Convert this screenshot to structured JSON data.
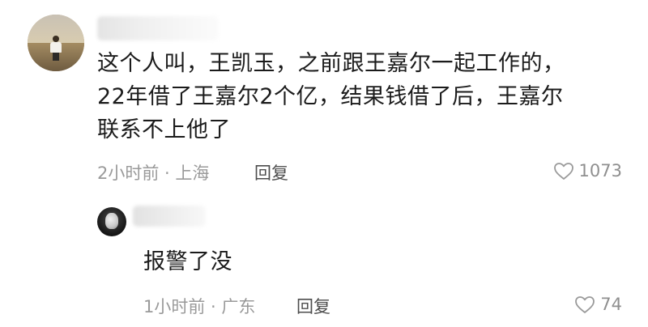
{
  "main_comment": {
    "username": "",
    "text_lines": [
      "这个人叫，王凯玉，之前跟王嘉尔一起工作的，",
      "22年借了王嘉尔2个亿，结果钱借了后，王嘉尔",
      "联系不上他了"
    ],
    "meta": "2小时前 · 上海",
    "reply_label": "回复",
    "like_count": "1073",
    "avatar_icon": "avatar-photo-person-field"
  },
  "reply_comment": {
    "username": "",
    "text": "报警了没",
    "meta": "1小时前 · 广东",
    "reply_label": "回复",
    "like_count": "74",
    "avatar_icon": "avatar-dark-round"
  },
  "colors": {
    "text": "#1b1b1b",
    "meta": "#9a9a9a",
    "reply": "#4d4d4d",
    "like": "#8f8f8f",
    "background": "#ffffff"
  },
  "icons": {
    "like": "heart-outline-icon"
  }
}
